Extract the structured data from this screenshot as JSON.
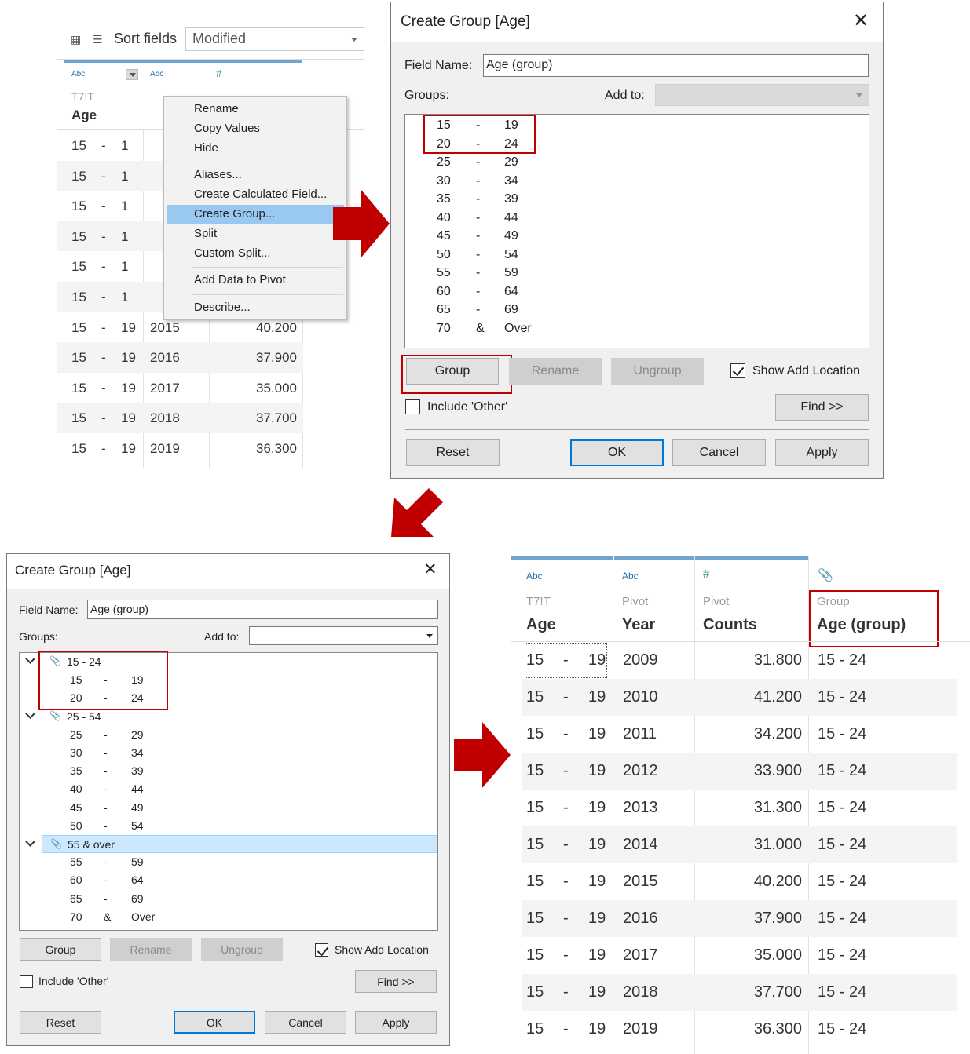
{
  "panel1": {
    "sort_label": "Sort fields",
    "sort_value": "Modified",
    "headers": [
      {
        "type": "Abc",
        "source": "T7!T",
        "name": "Age"
      },
      {
        "type": "Abc",
        "source": "",
        "name": ""
      },
      {
        "type": "#",
        "source": "",
        "name": ""
      }
    ],
    "rows": [
      {
        "a": "15",
        "d": "-",
        "b": "1",
        "year": "",
        "value": ""
      },
      {
        "a": "15",
        "d": "-",
        "b": "1",
        "year": "",
        "value": ""
      },
      {
        "a": "15",
        "d": "-",
        "b": "1",
        "year": "",
        "value": ""
      },
      {
        "a": "15",
        "d": "-",
        "b": "1",
        "year": "",
        "value": ""
      },
      {
        "a": "15",
        "d": "-",
        "b": "1",
        "year": "",
        "value": ""
      },
      {
        "a": "15",
        "d": "-",
        "b": "1",
        "year": "",
        "value": ""
      },
      {
        "a": "15",
        "d": "-",
        "b": "19",
        "year": "2015",
        "value": "40.200"
      },
      {
        "a": "15",
        "d": "-",
        "b": "19",
        "year": "2016",
        "value": "37.900"
      },
      {
        "a": "15",
        "d": "-",
        "b": "19",
        "year": "2017",
        "value": "35.000"
      },
      {
        "a": "15",
        "d": "-",
        "b": "19",
        "year": "2018",
        "value": "37.700"
      },
      {
        "a": "15",
        "d": "-",
        "b": "19",
        "year": "2019",
        "value": "36.300"
      }
    ],
    "menu": [
      "Rename",
      "Copy Values",
      "Hide",
      "Aliases...",
      "Create Calculated Field...",
      "Create Group...",
      "Split",
      "Custom Split...",
      "Add Data to Pivot",
      "Describe..."
    ]
  },
  "dialog1": {
    "title": "Create Group [Age]",
    "field_name_label": "Field Name:",
    "field_name_value": "Age (group)",
    "groups_label": "Groups:",
    "add_to_label": "Add to:",
    "items": [
      [
        "15",
        "-",
        "19"
      ],
      [
        "20",
        "-",
        "24"
      ],
      [
        "25",
        "-",
        "29"
      ],
      [
        "30",
        "-",
        "34"
      ],
      [
        "35",
        "-",
        "39"
      ],
      [
        "40",
        "-",
        "44"
      ],
      [
        "45",
        "-",
        "49"
      ],
      [
        "50",
        "-",
        "54"
      ],
      [
        "55",
        "-",
        "59"
      ],
      [
        "60",
        "-",
        "64"
      ],
      [
        "65",
        "-",
        "69"
      ],
      [
        "70",
        "&",
        "Over"
      ]
    ],
    "buttons": {
      "group": "Group",
      "rename": "Rename",
      "ungroup": "Ungroup",
      "find": "Find >>",
      "reset": "Reset",
      "ok": "OK",
      "cancel": "Cancel",
      "apply": "Apply"
    },
    "show_add_location": "Show Add Location",
    "include_other": "Include 'Other'"
  },
  "dialog2": {
    "title": "Create Group [Age]",
    "field_name_label": "Field Name:",
    "field_name_value": "Age (group)",
    "groups_label": "Groups:",
    "add_to_label": "Add to:",
    "groups": [
      {
        "name": "15 - 24",
        "items": [
          [
            "15",
            "-",
            "19"
          ],
          [
            "20",
            "-",
            "24"
          ]
        ]
      },
      {
        "name": "25 - 54",
        "items": [
          [
            "25",
            "-",
            "29"
          ],
          [
            "30",
            "-",
            "34"
          ],
          [
            "35",
            "-",
            "39"
          ],
          [
            "40",
            "-",
            "44"
          ],
          [
            "45",
            "-",
            "49"
          ],
          [
            "50",
            "-",
            "54"
          ]
        ]
      },
      {
        "name": "55 & over",
        "items": [
          [
            "55",
            "-",
            "59"
          ],
          [
            "60",
            "-",
            "64"
          ],
          [
            "65",
            "-",
            "69"
          ],
          [
            "70",
            "&",
            "Over"
          ]
        ]
      }
    ],
    "buttons": {
      "group": "Group",
      "rename": "Rename",
      "ungroup": "Ungroup",
      "find": "Find >>",
      "reset": "Reset",
      "ok": "OK",
      "cancel": "Cancel",
      "apply": "Apply"
    },
    "show_add_location": "Show Add Location",
    "include_other": "Include 'Other'"
  },
  "panel4": {
    "headers": [
      {
        "type": "Abc",
        "source": "T7!T",
        "name": "Age"
      },
      {
        "type": "Abc",
        "source": "Pivot",
        "name": "Year"
      },
      {
        "type": "#",
        "source": "Pivot",
        "name": "Counts"
      },
      {
        "type": "paperclip-icon",
        "source": "Group",
        "name": "Age (group)"
      }
    ],
    "rows": [
      {
        "a": "15",
        "d": "-",
        "b": "19",
        "year": "2009",
        "count": "31.800",
        "group": "15 - 24"
      },
      {
        "a": "15",
        "d": "-",
        "b": "19",
        "year": "2010",
        "count": "41.200",
        "group": "15 - 24"
      },
      {
        "a": "15",
        "d": "-",
        "b": "19",
        "year": "2011",
        "count": "34.200",
        "group": "15 - 24"
      },
      {
        "a": "15",
        "d": "-",
        "b": "19",
        "year": "2012",
        "count": "33.900",
        "group": "15 - 24"
      },
      {
        "a": "15",
        "d": "-",
        "b": "19",
        "year": "2013",
        "count": "31.300",
        "group": "15 - 24"
      },
      {
        "a": "15",
        "d": "-",
        "b": "19",
        "year": "2014",
        "count": "31.000",
        "group": "15 - 24"
      },
      {
        "a": "15",
        "d": "-",
        "b": "19",
        "year": "2015",
        "count": "40.200",
        "group": "15 - 24"
      },
      {
        "a": "15",
        "d": "-",
        "b": "19",
        "year": "2016",
        "count": "37.900",
        "group": "15 - 24"
      },
      {
        "a": "15",
        "d": "-",
        "b": "19",
        "year": "2017",
        "count": "35.000",
        "group": "15 - 24"
      },
      {
        "a": "15",
        "d": "-",
        "b": "19",
        "year": "2018",
        "count": "37.700",
        "group": "15 - 24"
      },
      {
        "a": "15",
        "d": "-",
        "b": "19",
        "year": "2019",
        "count": "36.300",
        "group": "15 - 24"
      }
    ]
  },
  "colors": {
    "accent_red": "#c00000",
    "arrow_red": "#c00000",
    "header_blue": "#6fa6d1",
    "menu_highlight": "#99c9f1"
  }
}
